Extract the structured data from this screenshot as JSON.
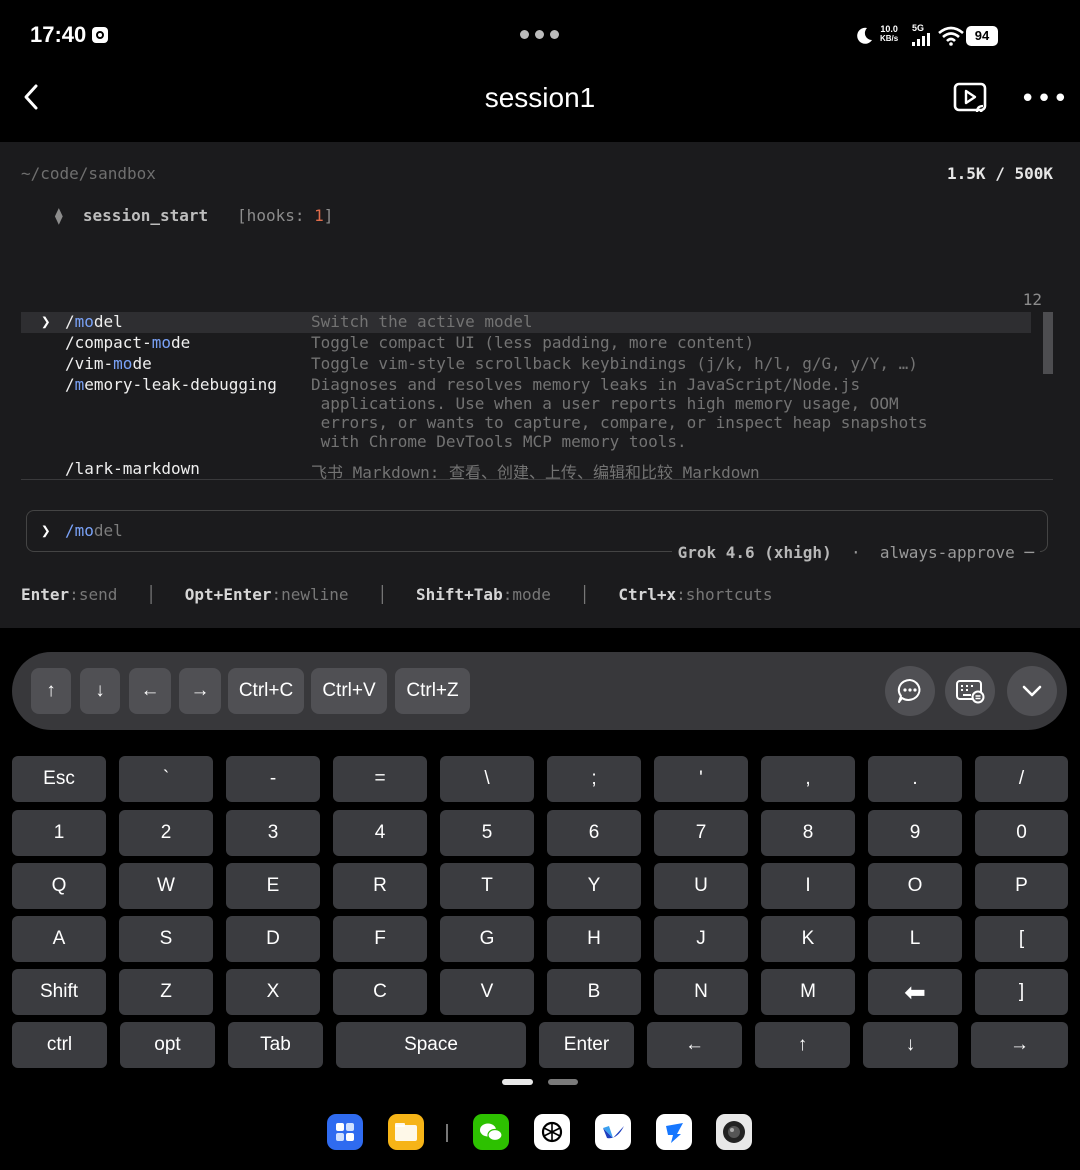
{
  "status_bar": {
    "time": "17:40",
    "net_speed_value": "10.0",
    "net_speed_unit": "KB/s",
    "network": "5G",
    "battery": "94"
  },
  "header": {
    "title": "session1"
  },
  "terminal": {
    "path": "~/code/sandbox",
    "tokens": "1.5K / 500K",
    "hook_marker": "⧫",
    "hook_name": "session_start",
    "hook_label_open": "[hooks: ",
    "hook_count": "1",
    "hook_label_close": "]",
    "list_count": "12",
    "commands": [
      {
        "pre": "/",
        "hl": "mo",
        "post": "del",
        "desc": "Switch the active model",
        "selected": true
      },
      {
        "pre": "/compact-",
        "hl": "mo",
        "post": "de",
        "desc": "Toggle compact UI (less padding, more content)"
      },
      {
        "pre": "/vim-",
        "hl": "mo",
        "post": "de",
        "desc": "Toggle vim-style scrollback keybindings (j/k, h/l, g/G, y/Y, …)"
      },
      {
        "pre": "/",
        "hl": "m",
        "post": "emory-leak-debugging",
        "desc": "Diagnoses and resolves memory leaks in JavaScript/Node.js\n applications. Use when a user reports high memory usage, OOM\n errors, or wants to capture, compare, or inspect heap snapshots\n with Chrome DevTools MCP memory tools."
      },
      {
        "pre": "/lark-markdo",
        "hl": "",
        "post": "wn",
        "desc": "飞书 Markdown: 查看、创建、上传、编辑和比较 Markdown"
      }
    ],
    "input_arrow": "❯",
    "input_typed": "/mo",
    "input_rest": "del",
    "model_name": "Grok 4.6",
    "model_effort": "(xhigh)",
    "approval_mode": "always-approve",
    "hints": [
      {
        "key": "Enter",
        "action": "send"
      },
      {
        "key": "Opt+Enter",
        "action": "newline"
      },
      {
        "key": "Shift+Tab",
        "action": "mode"
      },
      {
        "key": "Ctrl+x",
        "action": "shortcuts"
      }
    ]
  },
  "toolbar": {
    "keys": [
      "↑",
      "↓",
      "←",
      "→",
      "Ctrl+C",
      "Ctrl+V",
      "Ctrl+Z"
    ]
  },
  "keyboard": {
    "rows": [
      [
        "Esc",
        "`",
        "-",
        "=",
        "\\",
        ";",
        "'",
        ",",
        ".",
        "/"
      ],
      [
        "1",
        "2",
        "3",
        "4",
        "5",
        "6",
        "7",
        "8",
        "9",
        "0"
      ],
      [
        "Q",
        "W",
        "E",
        "R",
        "T",
        "Y",
        "U",
        "I",
        "O",
        "P"
      ],
      [
        "A",
        "S",
        "D",
        "F",
        "G",
        "H",
        "J",
        "K",
        "L",
        "["
      ],
      [
        "Shift",
        "Z",
        "X",
        "C",
        "V",
        "B",
        "N",
        "M",
        "⬅",
        "]"
      ],
      [
        "ctrl",
        "opt",
        "Tab",
        "Space",
        "Enter",
        "←",
        "↑",
        "↓",
        "→"
      ]
    ]
  },
  "dock": {
    "icons": [
      "apps-grid-icon",
      "files-icon",
      "wechat-icon",
      "chatgpt-icon",
      "lark-icon",
      "dingtalk-icon",
      "camera-icon"
    ]
  }
}
